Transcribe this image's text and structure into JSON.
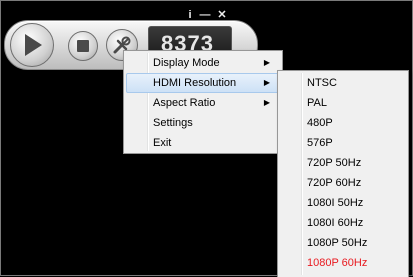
{
  "player": {
    "counter": "8373",
    "title_buttons": {
      "info": "i",
      "minimize": "—",
      "close": "✕"
    }
  },
  "context_menu": {
    "items": [
      {
        "label": "Display Mode",
        "has_submenu": true
      },
      {
        "label": "HDMI Resolution",
        "has_submenu": true,
        "highlighted": true
      },
      {
        "label": "Aspect Ratio",
        "has_submenu": true
      },
      {
        "label": "Settings",
        "has_submenu": false
      },
      {
        "label": "Exit",
        "has_submenu": false
      }
    ],
    "arrow": "▶"
  },
  "hdmi_submenu": {
    "items": [
      {
        "label": "NTSC"
      },
      {
        "label": "PAL"
      },
      {
        "label": "480P"
      },
      {
        "label": "576P"
      },
      {
        "label": "720P 50Hz"
      },
      {
        "label": "720P 60Hz"
      },
      {
        "label": "1080I 50Hz"
      },
      {
        "label": "1080I 60Hz"
      },
      {
        "label": "1080P 50Hz"
      },
      {
        "label": "1080P 60Hz",
        "selected": true
      }
    ],
    "selected_color": "#e8191f"
  }
}
